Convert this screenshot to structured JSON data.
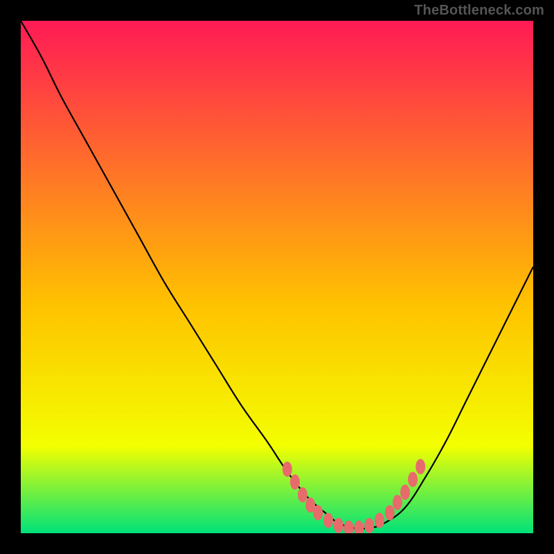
{
  "watermark": "TheBottleneck.com",
  "chart_data": {
    "type": "line",
    "title": "",
    "xlabel": "",
    "ylabel": "",
    "xlim": [
      0,
      100
    ],
    "ylim": [
      0,
      100
    ],
    "grid": false,
    "background_gradient": {
      "top": "#ff1a55",
      "mid": "#ffc100",
      "low": "#f3ff00",
      "bottom": "#00e27a"
    },
    "series": [
      {
        "name": "bottleneck-curve",
        "color": "#000000",
        "x": [
          0,
          4,
          8,
          13,
          18,
          23,
          28,
          33,
          38,
          43,
          48,
          52,
          56,
          60,
          62,
          65,
          68,
          71,
          75,
          79,
          83,
          87,
          91,
          95,
          100
        ],
        "y": [
          100,
          93,
          85,
          76,
          67,
          58,
          49,
          41,
          33,
          25,
          18,
          12,
          7,
          3.5,
          2,
          1,
          1,
          2,
          5,
          11,
          18,
          26,
          34,
          42,
          52
        ]
      }
    ],
    "markers": {
      "name": "highlight-band",
      "color": "#e86b6b",
      "points": [
        {
          "x": 52,
          "y": 12.5
        },
        {
          "x": 53.5,
          "y": 10
        },
        {
          "x": 55,
          "y": 7.5
        },
        {
          "x": 56.5,
          "y": 5.5
        },
        {
          "x": 58,
          "y": 4
        },
        {
          "x": 60,
          "y": 2.5
        },
        {
          "x": 62,
          "y": 1.5
        },
        {
          "x": 64,
          "y": 1
        },
        {
          "x": 66,
          "y": 1
        },
        {
          "x": 68,
          "y": 1.5
        },
        {
          "x": 70,
          "y": 2.5
        },
        {
          "x": 72,
          "y": 4
        },
        {
          "x": 73.5,
          "y": 6
        },
        {
          "x": 75,
          "y": 8
        },
        {
          "x": 76.5,
          "y": 10.5
        },
        {
          "x": 78,
          "y": 13
        }
      ]
    }
  }
}
